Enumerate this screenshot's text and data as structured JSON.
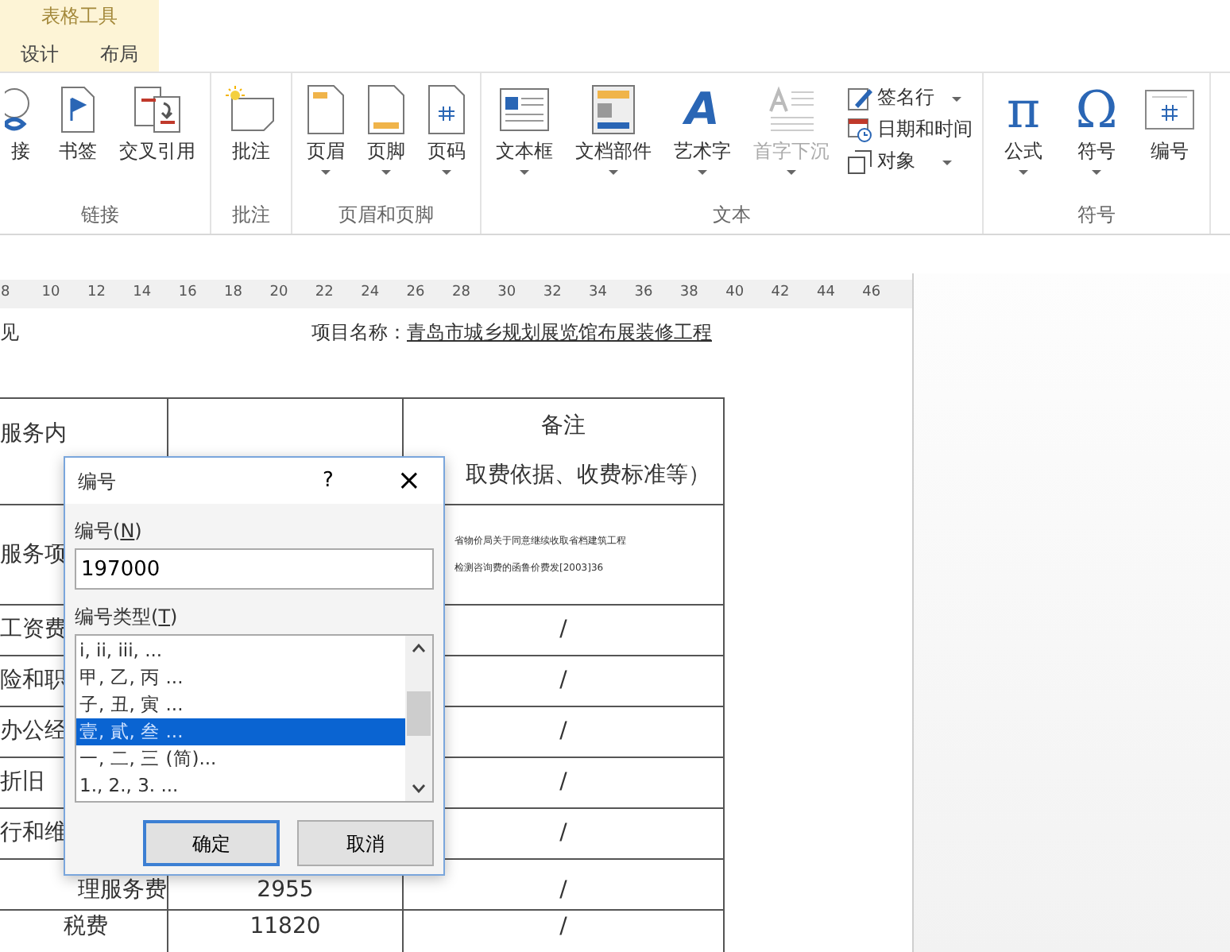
{
  "ribbon": {
    "context_label": "表格工具",
    "tabs": [
      {
        "label": "设计",
        "selected": false
      },
      {
        "label": "布局",
        "selected": false
      }
    ],
    "groups": [
      {
        "label": "链接",
        "items": [
          {
            "kind": "large",
            "label": "接",
            "dropdown": false,
            "disabled": false
          },
          {
            "kind": "large",
            "label": "书签",
            "dropdown": false,
            "disabled": false
          },
          {
            "kind": "large",
            "label": "交叉引用",
            "dropdown": false,
            "disabled": false
          }
        ]
      },
      {
        "label": "批注",
        "items": [
          {
            "kind": "large",
            "label": "批注",
            "dropdown": false,
            "disabled": false
          }
        ]
      },
      {
        "label": "页眉和页脚",
        "items": [
          {
            "kind": "large",
            "label": "页眉",
            "dropdown": true,
            "disabled": false
          },
          {
            "kind": "large",
            "label": "页脚",
            "dropdown": true,
            "disabled": false
          },
          {
            "kind": "large",
            "label": "页码",
            "dropdown": true,
            "disabled": false
          }
        ]
      },
      {
        "label": "文本",
        "items": [
          {
            "kind": "large",
            "label": "文本框",
            "dropdown": true,
            "disabled": false
          },
          {
            "kind": "large",
            "label": "文档部件",
            "dropdown": true,
            "disabled": false
          },
          {
            "kind": "large",
            "label": "艺术字",
            "dropdown": true,
            "disabled": false,
            "glyph": "A"
          },
          {
            "kind": "large",
            "label": "首字下沉",
            "dropdown": true,
            "disabled": true
          },
          {
            "kind": "stack",
            "items": [
              {
                "label": "签名行",
                "dropdown": true
              },
              {
                "label": "日期和时间",
                "dropdown": false
              },
              {
                "label": "对象",
                "dropdown": true
              }
            ]
          }
        ]
      },
      {
        "label": "符号",
        "items": [
          {
            "kind": "large",
            "label": "公式",
            "dropdown": true,
            "disabled": false,
            "glyph": "π"
          },
          {
            "kind": "large",
            "label": "符号",
            "dropdown": true,
            "disabled": false,
            "glyph": "Ω"
          },
          {
            "kind": "large",
            "label": "编号",
            "dropdown": false,
            "disabled": false
          }
        ]
      }
    ]
  },
  "ruler": {
    "marks": [
      "8",
      "10",
      "12",
      "14",
      "16",
      "18",
      "20",
      "22",
      "24",
      "26",
      "28",
      "30",
      "32",
      "34",
      "36",
      "38",
      "40",
      "42",
      "44",
      "46"
    ]
  },
  "document": {
    "left_fragment": "见",
    "project_label": "项目名称：",
    "project_name": "青岛市城乡规划展览馆布展装修工程",
    "table": {
      "header": {
        "column_1": "服务内",
        "column_3_title": "备注",
        "column_3_note": "取费依据、收费标准等）"
      },
      "rows": [
        {
          "column_1": "服务项",
          "column_3_lines": [
            "省物价局关于同意继续收取省档建筑工程",
            "检测咨询费的函鲁价费发[2003]36"
          ]
        },
        {
          "column_1": "工资费",
          "column_3": "/"
        },
        {
          "column_1": "险和职",
          "column_3": "/"
        },
        {
          "column_1": "办公经",
          "column_3": "/"
        },
        {
          "column_1": "折旧",
          "column_3": "/"
        },
        {
          "column_1": "行和维",
          "column_3": "/"
        },
        {
          "column_1": "理服务费",
          "column_2": "2955",
          "column_3": "/"
        },
        {
          "column_1": "税费",
          "column_2": "11820",
          "column_3": "/"
        }
      ]
    }
  },
  "dialog": {
    "title": "编号",
    "help": "?",
    "close": "×",
    "number_label": {
      "before": "编号(",
      "key": "N",
      "after": ")"
    },
    "number_value": "197000",
    "type_label": {
      "before": "编号类型(",
      "key": "T",
      "after": ")"
    },
    "types": [
      {
        "label": "i, ii, iii, ...",
        "selected": false
      },
      {
        "label": "甲, 乙, 丙 ...",
        "selected": false
      },
      {
        "label": "子, 丑, 寅 ...",
        "selected": false
      },
      {
        "label": "壹, 貳, 叁 ...",
        "selected": true
      },
      {
        "label": "一, 二, 三 (简)...",
        "selected": false
      },
      {
        "label": "1., 2., 3. ...",
        "selected": false
      }
    ],
    "ok": "确定",
    "cancel": "取消"
  }
}
